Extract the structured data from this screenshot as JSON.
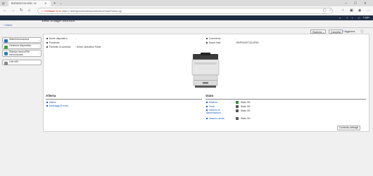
{
  "browser": {
    "tab_title": "RNP00267C0C4FB3 - W",
    "security_warning": "Certificate error",
    "url": "https://                          /web/guest/it/websys/webArch/mainFrame.cgi"
  },
  "header": {
    "right_label": "Login",
    "page_title": "Web Image Monitor"
  },
  "breadcrumb": {
    "home": "Home"
  },
  "sidebar": {
    "items": [
      {
        "label": "Stato/Informazioni",
        "color": "#2a6fc9"
      },
      {
        "label": "Gestione dispositivo",
        "color": "#3f9a3a"
      },
      {
        "label": "Stampa lavoro/File memorizzato",
        "color": "#2c7fbf"
      },
      {
        "label": "Link utili",
        "color": "#888888"
      }
    ]
  },
  "toolbar": {
    "select_value": "Sistema",
    "delete_label": "Cancella",
    "refresh_label": "Aggiorna"
  },
  "device_info": {
    "left": [
      {
        "label": "Nome dispositivo",
        "value": ""
      },
      {
        "label": "Posizione",
        "value": ""
      },
      {
        "label": "Pannello di controllo",
        "value": "Smart Operation Panel"
      }
    ],
    "right": [
      {
        "label": "Commento",
        "value": ""
      },
      {
        "label": "Nome host",
        "value": "RNP00267C0C4FB3"
      }
    ]
  },
  "alerts": {
    "title": "Allerta",
    "items": [
      {
        "label": "Allerta"
      },
      {
        "label": "Messaggi (Errore)"
      }
    ]
  },
  "status": {
    "title": "Stato",
    "items": [
      {
        "label": "Sistema",
        "value": "Stato OK"
      },
      {
        "label": "Toner",
        "value": "Stato OK"
      },
      {
        "label": "Vassoio di alimentazione",
        "value": "Stato OK"
      },
      {
        "label": "Vassoio uscita",
        "value": "Stato OK"
      }
    ]
  },
  "footer_button": {
    "label": "Controllo dettagli"
  }
}
